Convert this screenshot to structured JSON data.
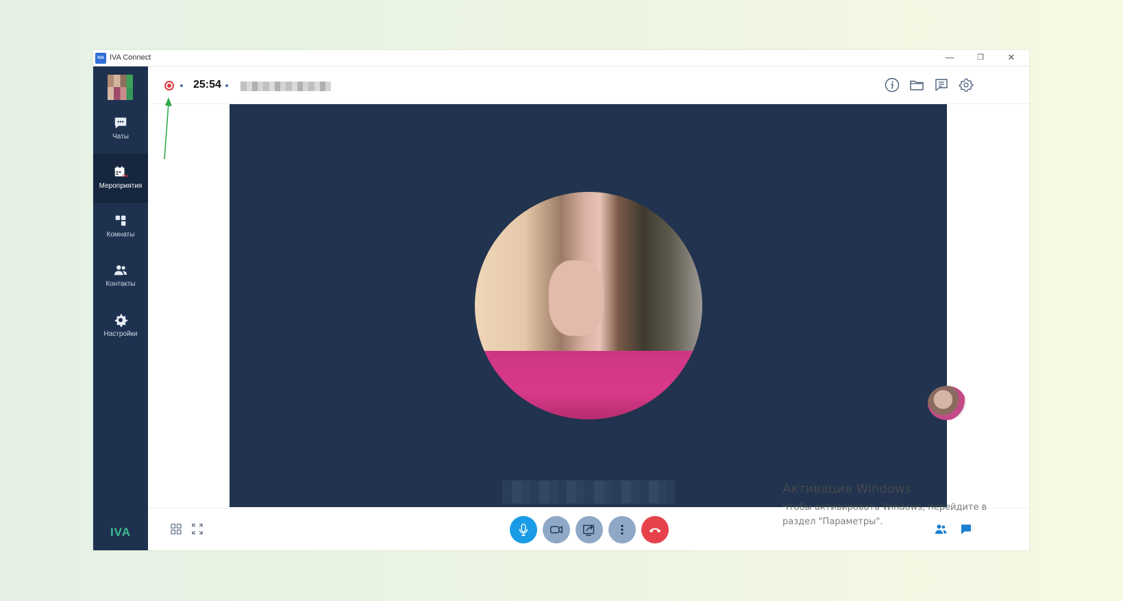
{
  "window": {
    "app_logo": "IVA",
    "title": "IVA Connect",
    "min_glyph": "—",
    "max_glyph": "❐",
    "close_glyph": "✕"
  },
  "sidebar": {
    "items": [
      {
        "label": "Чаты",
        "icon": "chat-bubble-icon"
      },
      {
        "label": "Мероприятия",
        "icon": "calendar-live-icon",
        "active": true
      },
      {
        "label": "Комнаты",
        "icon": "rooms-icon"
      },
      {
        "label": "Контакты",
        "icon": "contacts-icon"
      },
      {
        "label": "Настройки",
        "icon": "gear-icon"
      }
    ],
    "brand": "IVA"
  },
  "topbar": {
    "recording": true,
    "timer": "25:54",
    "icons": [
      "info-icon",
      "folder-icon",
      "chat-list-icon",
      "settings-icon"
    ]
  },
  "controls": {
    "left_icons": [
      "grid-layout-icon",
      "fullscreen-icon"
    ],
    "center": [
      "microphone-icon",
      "camera-icon",
      "screen-share-icon",
      "more-icon",
      "hangup-icon"
    ],
    "right_icons": [
      "participants-icon",
      "chat-icon"
    ]
  },
  "windows_activation": {
    "title": "Активация Windows",
    "subtitle": "Чтобы активировать Windows, перейдите в раздел \"Параметры\"."
  },
  "colors": {
    "sidebar": "#1e3250",
    "stage": "#21334e",
    "mic_active": "#1a9be6",
    "control_inactive": "#8fa8c7",
    "hangup": "#e6424b",
    "record": "#e0383e",
    "annotation_arrow": "#2faa4a"
  }
}
